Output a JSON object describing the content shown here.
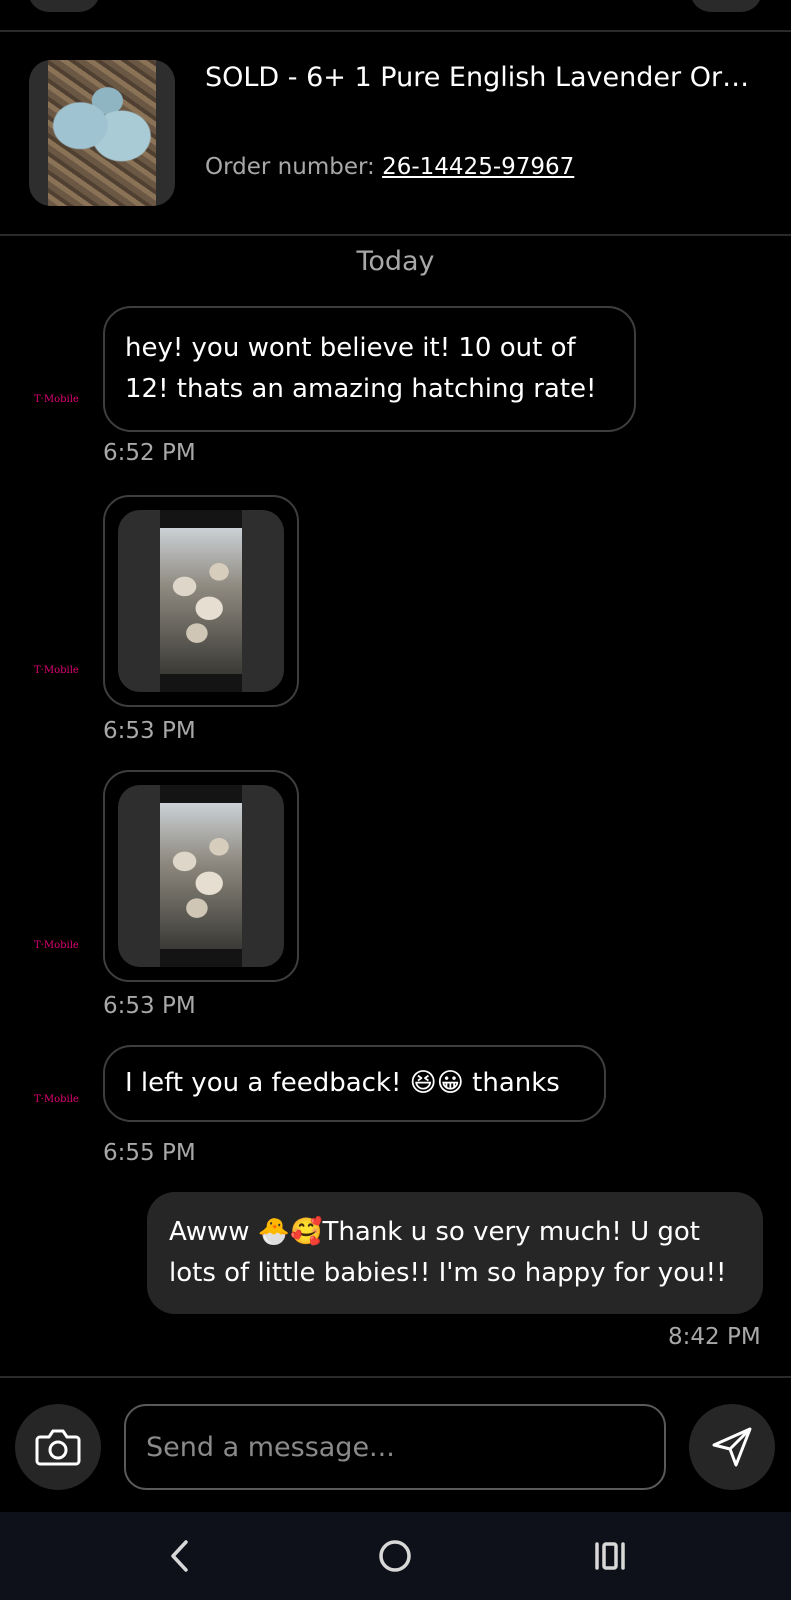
{
  "item": {
    "title": "SOLD - 6+ 1 Pure English Lavender Orpi...",
    "order_label": "Order number: ",
    "order_number": "26-14425-97967"
  },
  "day_separator": "Today",
  "sender_avatar": {
    "brand": "T·Mobile"
  },
  "messages": [
    {
      "type": "text",
      "direction": "in",
      "text": "hey! you wont believe it! 10 out of 12! thats an amazing hatching rate!",
      "time": "6:52 PM"
    },
    {
      "type": "image",
      "direction": "in",
      "time": "6:53 PM"
    },
    {
      "type": "image",
      "direction": "in",
      "time": "6:53 PM"
    },
    {
      "type": "text",
      "direction": "in",
      "text": "I left you a feedback! 😆😀 thanks",
      "time": "6:55 PM"
    },
    {
      "type": "text",
      "direction": "out",
      "text": "Awww 🐣🥰Thank u so very much! U got lots of little babies!! I'm so happy for you!!",
      "time": "8:42 PM"
    }
  ],
  "composer": {
    "placeholder": "Send a message..."
  },
  "icons": {
    "camera": "camera-icon",
    "send": "send-icon",
    "back": "back-nav-icon",
    "home": "home-nav-icon",
    "recents": "recents-nav-icon"
  }
}
